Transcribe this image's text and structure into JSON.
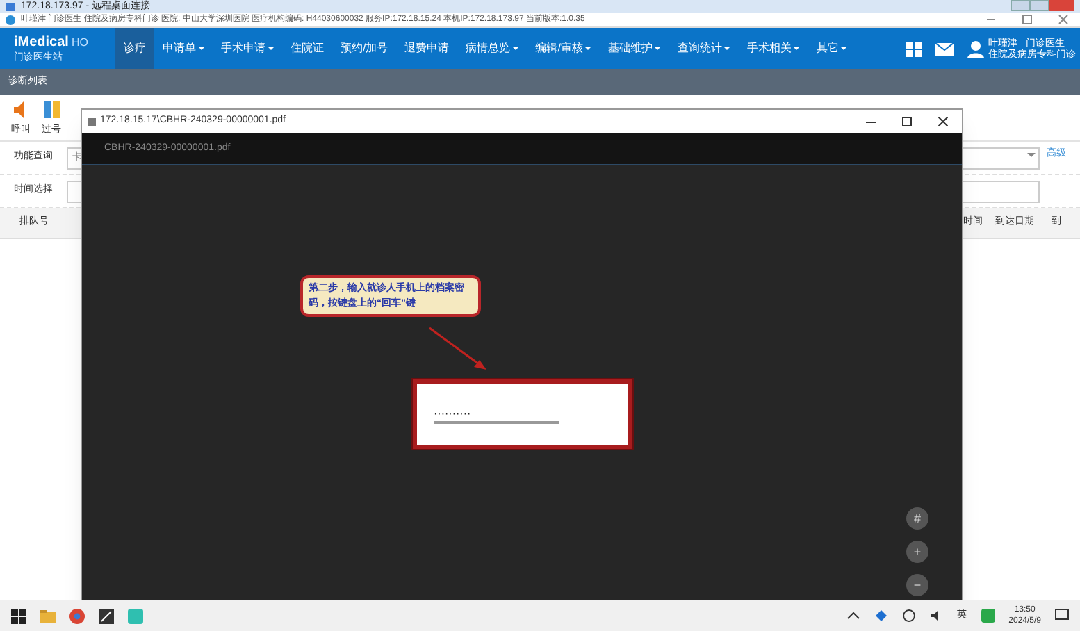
{
  "remote_window": {
    "title": "172.18.173.97 - 远程桌面连接"
  },
  "info_bar": {
    "text": "叶瑾津  门诊医生 住院及病房专科门诊  医院: 中山大学深圳医院  医疗机构编码: H44030600032  服务IP:172.18.15.24  本机IP:172.18.173.97  当前版本:1.0.35"
  },
  "app_header": {
    "logo": "iMedical",
    "logo_suffix": "HO",
    "subtitle": "门诊医生站",
    "menu": [
      {
        "label": "诊疗",
        "selected": true,
        "dropdown": false
      },
      {
        "label": "申请单",
        "selected": false,
        "dropdown": true
      },
      {
        "label": "手术申请",
        "selected": false,
        "dropdown": true
      },
      {
        "label": "住院证",
        "selected": false,
        "dropdown": false
      },
      {
        "label": "预约/加号",
        "selected": false,
        "dropdown": false
      },
      {
        "label": "退费申请",
        "selected": false,
        "dropdown": false
      },
      {
        "label": "病情总览",
        "selected": false,
        "dropdown": true
      },
      {
        "label": "编辑/审核",
        "selected": false,
        "dropdown": true
      },
      {
        "label": "基础维护",
        "selected": false,
        "dropdown": true
      },
      {
        "label": "查询统计",
        "selected": false,
        "dropdown": true
      },
      {
        "label": "手术相关",
        "selected": false,
        "dropdown": true
      },
      {
        "label": "其它",
        "selected": false,
        "dropdown": true
      }
    ],
    "user": {
      "name": "叶瑾津",
      "role": "门诊医生",
      "department": "住院及病房专科门诊"
    }
  },
  "section_bar": {
    "title": "诊断列表"
  },
  "toolbar": [
    {
      "label": "呼叫"
    },
    {
      "label": "过号"
    }
  ],
  "filters": [
    {
      "label": "功能查询",
      "placeholder": "卡"
    },
    {
      "label": "时间选择"
    }
  ],
  "advanced_link": "高级",
  "table": {
    "columns_left": [
      "排队号"
    ],
    "columns_right": [
      "时间",
      "到达日期",
      "到"
    ]
  },
  "pdf_viewer": {
    "title": "172.18.15.17\\CBHR-240329-00000001.pdf",
    "file_name": "CBHR-240329-00000001.pdf",
    "callout": "第二步，输入就诊人手机上的档案密码，按键盘上的“回车”键",
    "password": {
      "value": "··········"
    },
    "zoom_controls": [
      "#",
      "+",
      "−"
    ]
  },
  "taskbar": {
    "time": "13:50",
    "date": "2024/5/9",
    "input_method": "英"
  }
}
